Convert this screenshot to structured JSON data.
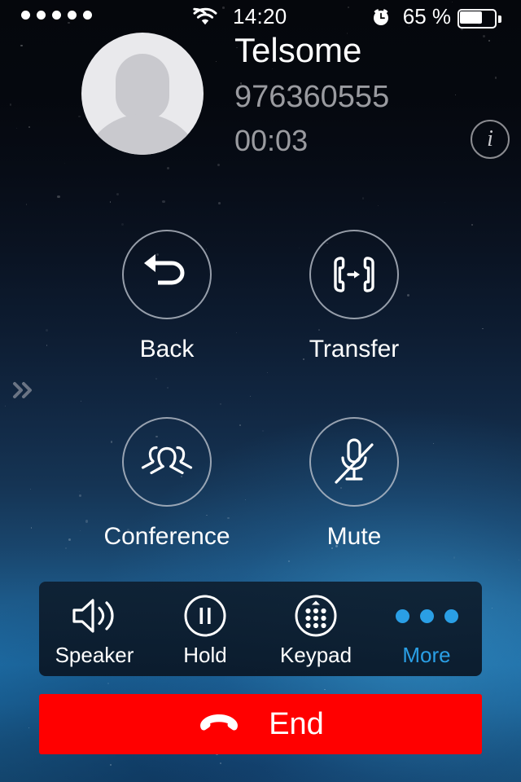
{
  "status_bar": {
    "signal_dots": 5,
    "wifi_icon": "wifi-icon",
    "time": "14:20",
    "alarm_icon": "alarm-clock-icon",
    "battery_percent": "65 %",
    "battery_level": 65,
    "battery_icon": "battery-icon"
  },
  "call": {
    "avatar_icon": "default-contact-avatar",
    "contact_name": "Telsome",
    "phone_number": "976360555",
    "duration": "00:03",
    "info_icon": "info-icon",
    "side_chevron_icon": "double-chevron-right-icon"
  },
  "actions": [
    {
      "key": "back",
      "label": "Back",
      "icon": "undo-arrow-icon"
    },
    {
      "key": "transfer",
      "label": "Transfer",
      "icon": "call-transfer-icon"
    },
    {
      "key": "conference",
      "label": "Conference",
      "icon": "group-people-icon"
    },
    {
      "key": "mute",
      "label": "Mute",
      "icon": "microphone-muted-icon"
    }
  ],
  "toolbar": [
    {
      "key": "speaker",
      "label": "Speaker",
      "icon": "speaker-icon"
    },
    {
      "key": "hold",
      "label": "Hold",
      "icon": "pause-circle-icon"
    },
    {
      "key": "keypad",
      "label": "Keypad",
      "icon": "dialpad-icon"
    },
    {
      "key": "more",
      "label": "More",
      "icon": "three-dots-icon"
    }
  ],
  "end_call": {
    "label": "End",
    "icon": "hang-up-handset-icon"
  },
  "colors": {
    "end_button": "#ff0000",
    "more_accent": "#2a9fe5",
    "secondary_text": "#9a9ba0",
    "primary_text": "#ffffff"
  }
}
